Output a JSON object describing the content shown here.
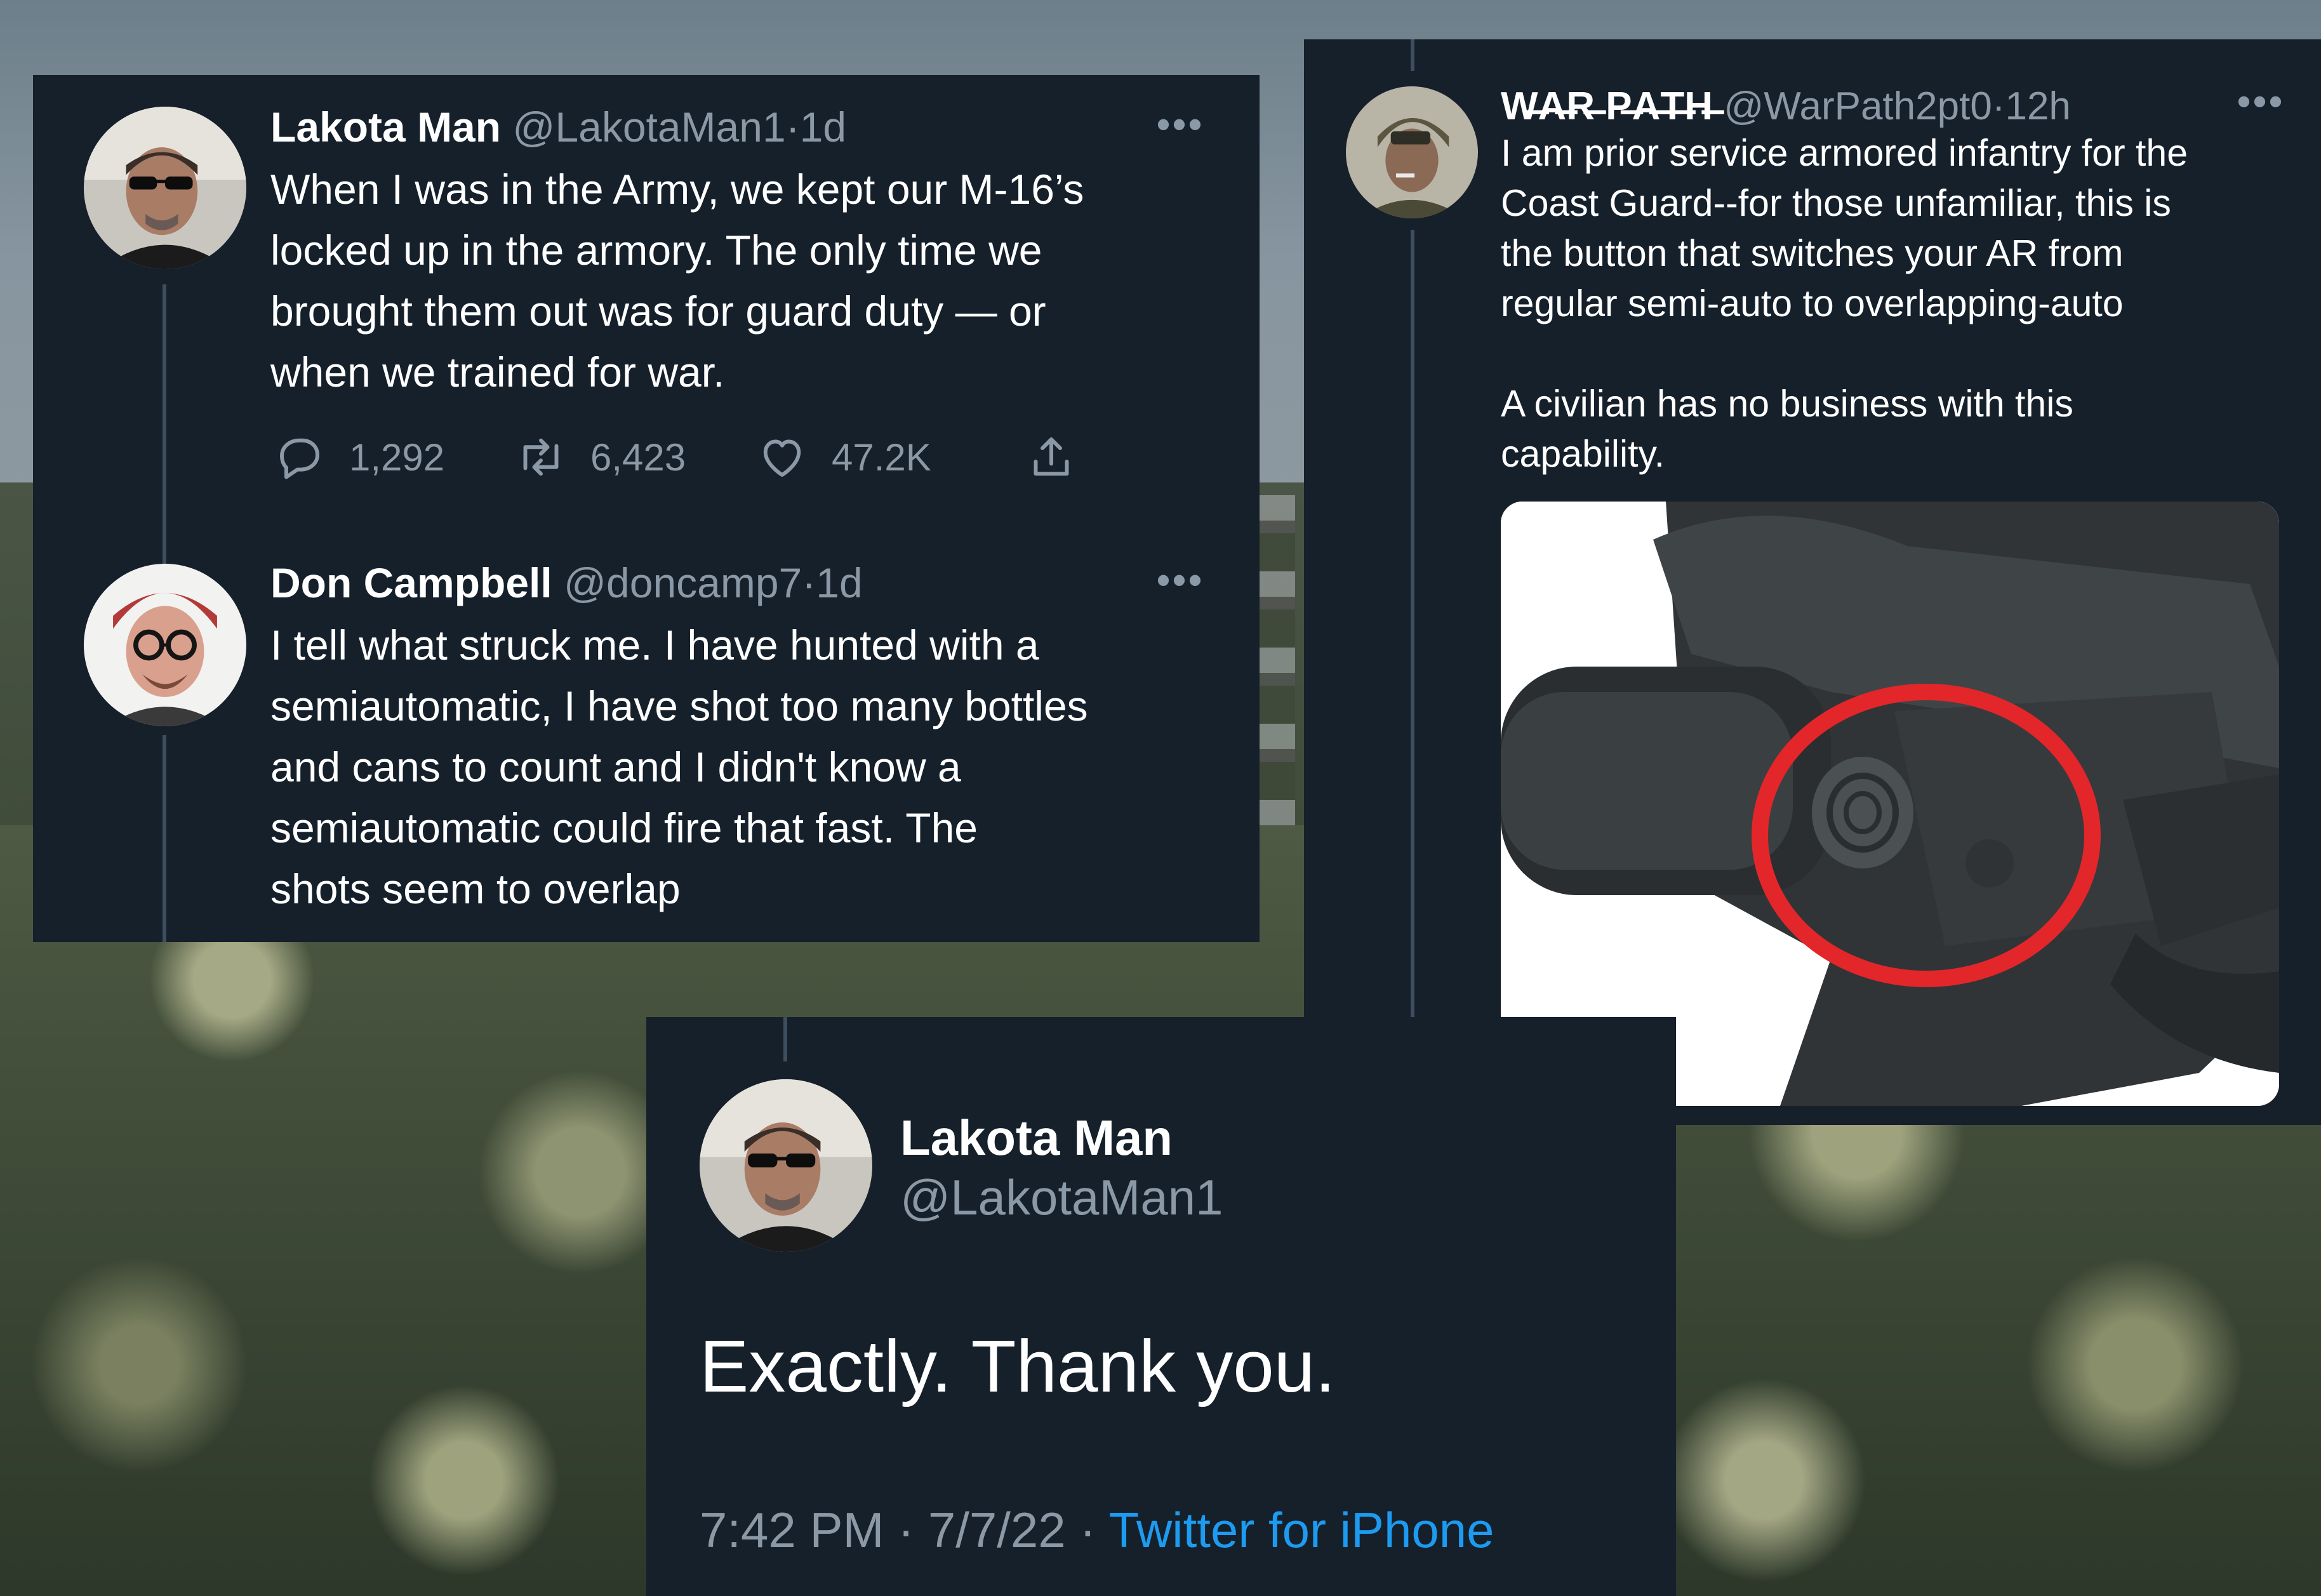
{
  "thread": [
    {
      "name": "Lakota Man",
      "handle": "@LakotaMan1",
      "time": "1d",
      "text": "When I was in the Army, we kept our M-16’s\nlocked up in the armory. The only time we\nbrought them out was for guard duty — or\nwhen we trained for war.",
      "actions": [
        {
          "icon": "reply-icon",
          "count": "1,292"
        },
        {
          "icon": "retweet-icon",
          "count": "6,423"
        },
        {
          "icon": "like-icon",
          "count": "47.2K"
        },
        {
          "icon": "share-icon",
          "count": ""
        }
      ],
      "more": "•••"
    },
    {
      "name": "Don Campbell",
      "handle": "@doncamp7",
      "time": "1d",
      "text": "I tell what struck me. I have hunted with a\nsemiautomatic, I have shot too many bottles\nand cans to count and I didn't know a\nsemiautomatic could fire that fast. The\nshots seem to overlap",
      "more": "•••"
    }
  ],
  "quoted": {
    "name": "W̶A̶R̶ P̶A̶T̶H̶",
    "handle": "@WarPath2pt0",
    "time": "12h",
    "text": "I am prior service armored infantry for the\nCoast Guard--for those unfamiliar, this is\nthe button that switches your AR from\nregular semi-auto to overlapping-auto\n\nA civilian has no business with this\ncapability.",
    "more": "•••",
    "image_icon": "rifle-receiver-photo"
  },
  "reply": {
    "name": "Lakota Man",
    "handle": "@LakotaMan1",
    "text": "Exactly. Thank you.",
    "time": "7:42 PM",
    "date": "7/7/22",
    "source": "Twitter for iPhone"
  },
  "separator": "·",
  "colors": {
    "panel": "#15202b",
    "secondary_text": "#8b98a5",
    "link": "#1d9bf0",
    "highlight_circle": "#e3262a"
  }
}
